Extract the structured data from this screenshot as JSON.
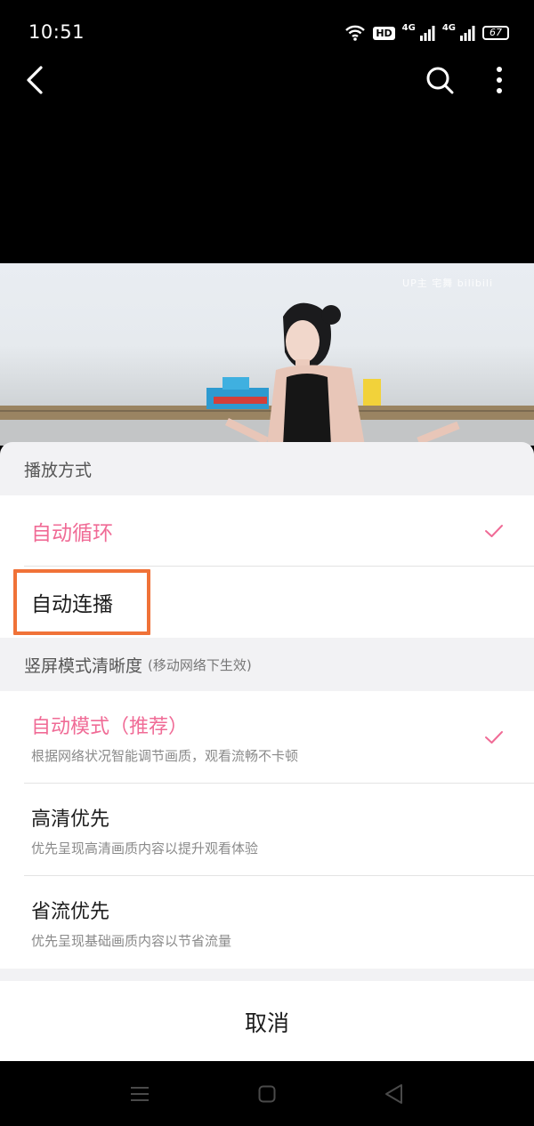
{
  "status_bar": {
    "time": "10:51",
    "hd_badge": "HD",
    "signal1_label": "4G",
    "signal2_label": "4G",
    "battery": "67",
    "icons": [
      "wifi-icon",
      "hd-icon",
      "signal-4g-icon",
      "signal-4g-icon",
      "battery-icon"
    ]
  },
  "top_nav": {
    "icons": [
      "back-arrow-icon",
      "search-icon",
      "more-vertical-icon"
    ]
  },
  "video": {
    "watermark": "UP主  宅舞 bilibili"
  },
  "sheet": {
    "playback_header": "播放方式",
    "playback_options": [
      {
        "label": "自动循环",
        "selected": true
      },
      {
        "label": "自动连播",
        "selected": false
      }
    ],
    "quality_header": "竖屏模式清晰度",
    "quality_note": "(移动网络下生效)",
    "quality_options": [
      {
        "label": "自动模式（推荐）",
        "desc": "根据网络状况智能调节画质，观看流畅不卡顿",
        "selected": true
      },
      {
        "label": "高清优先",
        "desc": "优先呈现高清画质内容以提升观看体验",
        "selected": false
      },
      {
        "label": "省流优先",
        "desc": "优先呈现基础画质内容以节省流量",
        "selected": false
      }
    ],
    "cancel_label": "取消"
  },
  "colors": {
    "accent": "#f06b96",
    "highlight": "#f07238"
  }
}
